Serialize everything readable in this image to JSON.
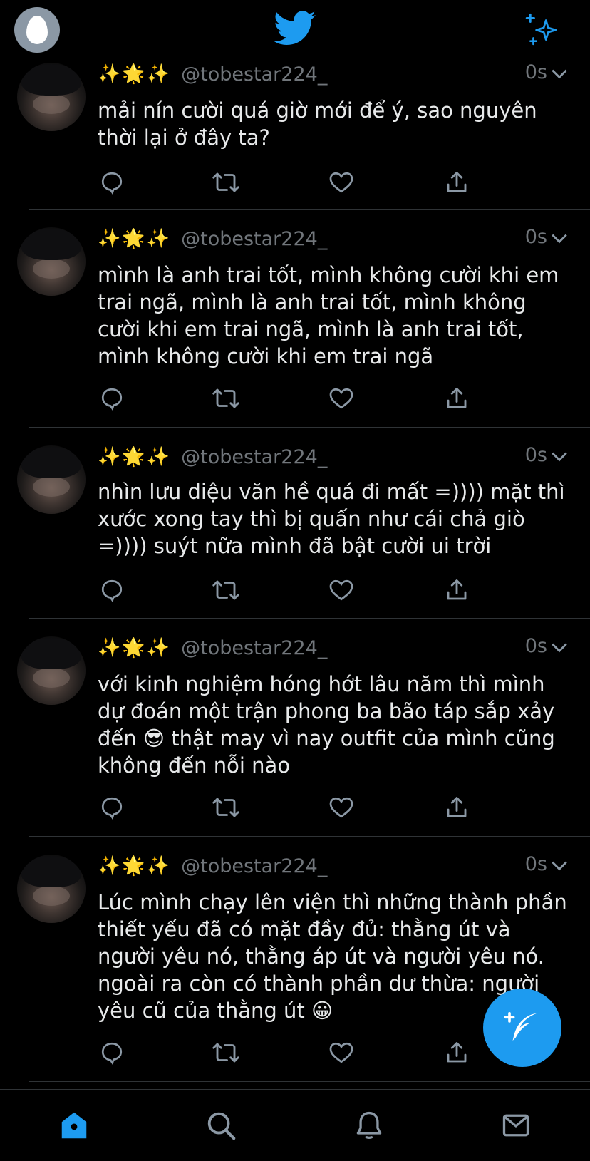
{
  "header": {
    "profile_icon": "egg-avatar-icon",
    "logo_icon": "twitter-bird-icon",
    "sparkle_icon": "sparkle-icon"
  },
  "tweets": [
    {
      "sparkles": "✨🌟✨",
      "handle": "@tobestar224_",
      "time": "0s",
      "text": "mải nín cười quá giờ mới để ý, sao nguyên thời lại ở đây ta?"
    },
    {
      "sparkles": "✨🌟✨",
      "handle": "@tobestar224_",
      "time": "0s",
      "text": "mình là anh trai tốt, mình không cười khi em trai ngã, mình là anh trai tốt, mình không cười khi em trai ngã, mình là anh trai tốt, mình không cười khi em trai ngã"
    },
    {
      "sparkles": "✨🌟✨",
      "handle": "@tobestar224_",
      "time": "0s",
      "text": "nhìn lưu diệu văn hề quá đi mất =)))) mặt thì xước xong tay thì bị quấn như cái chả giò =)))) suýt nữa mình đã bật cười ui trời"
    },
    {
      "sparkles": "✨🌟✨",
      "handle": "@tobestar224_",
      "time": "0s",
      "text": "với kinh nghiệm hóng hớt lâu năm thì mình dự đoán một trận phong ba bão táp sắp xảy đến 😎 thật may vì nay outfit của mình cũng không đến nỗi nào"
    },
    {
      "sparkles": "✨🌟✨",
      "handle": "@tobestar224_",
      "time": "0s",
      "text": "Lúc mình chạy lên viện thì những thành phần thiết yếu đã có mặt đầy đủ: thằng út và người yêu nó, thằng áp út và người yêu nó. ngoài ra còn có thành phần dư thừa: người yêu cũ của thằng út 😀"
    }
  ],
  "tabs": [
    "home-icon",
    "search-icon",
    "notifications-icon",
    "messages-icon"
  ],
  "colors": {
    "accent": "#1d9bf0",
    "muted": "#71767b",
    "divider": "#2f3336"
  }
}
